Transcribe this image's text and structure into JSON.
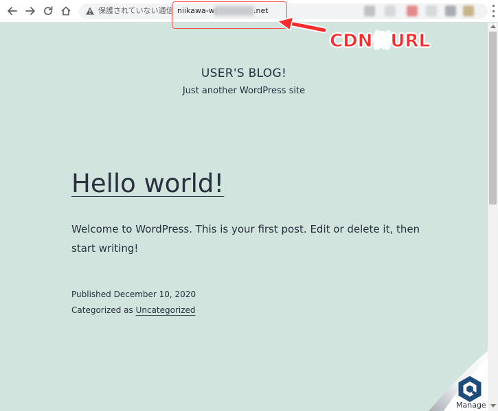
{
  "browser": {
    "security_label": "保護されていない通信",
    "url_prefix": "niikawa-wp.",
    "url_suffix": ".net",
    "icons": {
      "back": "arrow-left-icon",
      "forward": "arrow-right-icon",
      "reload": "reload-icon",
      "home": "home-icon",
      "security": "warning-triangle-icon",
      "menu": "three-dots-vertical-icon"
    }
  },
  "annotation": {
    "label": "CDN側URL",
    "color": "#ff2b2b"
  },
  "site": {
    "title": "USER'S BLOG!",
    "description": "Just another WordPress site"
  },
  "post": {
    "title": "Hello world!",
    "body": "Welcome to WordPress. This is your first post. Edit or delete it, then start writing!",
    "published_prefix": "Published",
    "published_date": "December 10, 2020",
    "categorized_prefix": "Categorized as",
    "category": "Uncategorized"
  },
  "manage": {
    "label": "Manage",
    "icon": "hexagon-logo-icon"
  },
  "colors": {
    "page_background": "#d1e4dd",
    "text": "#28303d",
    "highlight": "#ff4d4d"
  }
}
